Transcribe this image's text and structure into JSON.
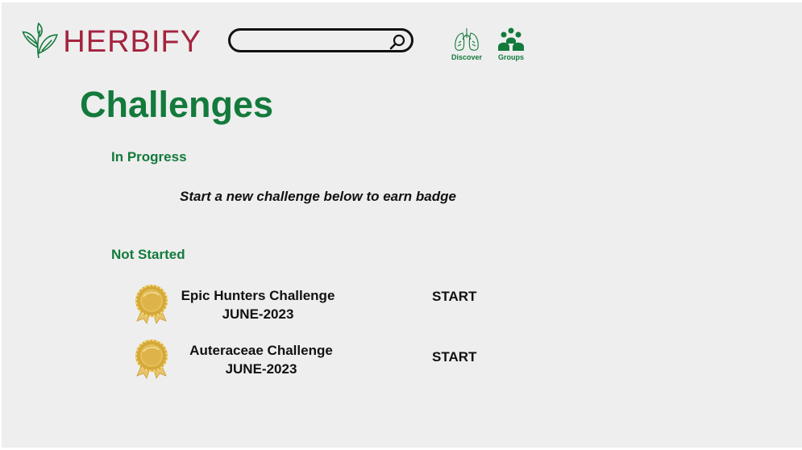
{
  "brand": {
    "name": "HERBIFY",
    "color": "#a3243e",
    "accent": "#137a3c"
  },
  "search": {
    "placeholder": "",
    "value": ""
  },
  "nav": [
    {
      "label": "Discover",
      "icon": "lungs-icon"
    },
    {
      "label": "Groups",
      "icon": "group-icon"
    }
  ],
  "page": {
    "title": "Challenges"
  },
  "sections": {
    "in_progress": {
      "label": "In Progress",
      "empty_hint": "Start a new challenge below to earn badge"
    },
    "not_started": {
      "label": "Not Started"
    }
  },
  "challenges": [
    {
      "name": "Epic Hunters Challenge",
      "date": "JUNE-2023",
      "action": "START",
      "icon": "medal-icon"
    },
    {
      "name": "Auteraceae Challenge",
      "date": "JUNE-2023",
      "action": "START",
      "icon": "medal-icon"
    }
  ]
}
